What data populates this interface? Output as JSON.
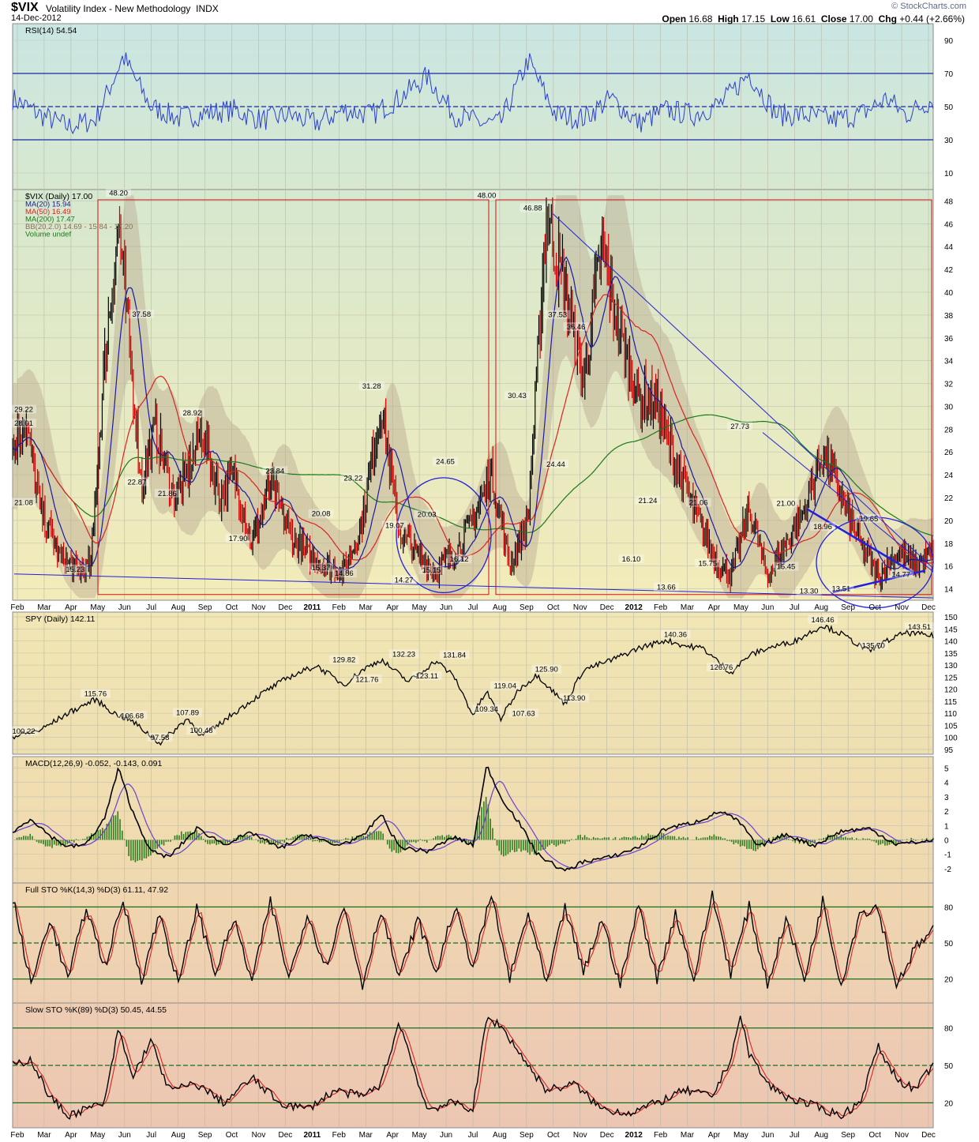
{
  "header": {
    "symbol": "$VIX",
    "name": "Volatility Index - New Methodology",
    "exchange": "INDX",
    "date": "14-Dec-2012",
    "open_label": "Open",
    "open": "16.68",
    "high_label": "High",
    "high": "17.15",
    "low_label": "Low",
    "low": "16.61",
    "close_label": "Close",
    "close": "17.00",
    "chg_label": "Chg",
    "chg": "+0.44 (+2.66%)",
    "credit": "© StockCharts.com"
  },
  "colors": {
    "ma20": "#1a1aa0",
    "ma50": "#dd2222",
    "ma200": "#1a7a1a",
    "bb_fill": "#b7a890",
    "up_bar": "#000000",
    "down_bar": "#cc0000",
    "annotation_box": "#cc1111",
    "annotation_line": "#2020dd",
    "macd_hist": "#2e7d1e",
    "signal": "#6b3fcf"
  },
  "chart_data": [
    {
      "type": "line",
      "panel": "rsi",
      "legend": "RSI(14) 54.54",
      "y_ticks": [
        10,
        30,
        50,
        70,
        90
      ],
      "ylim": [
        0,
        100
      ],
      "reference_lines": [
        30,
        50,
        70
      ],
      "x": [
        0,
        0.03,
        0.06,
        0.09,
        0.12,
        0.15,
        0.18,
        0.21,
        0.24,
        0.27,
        0.3,
        0.33,
        0.36,
        0.39,
        0.42,
        0.45,
        0.48,
        0.51,
        0.53,
        0.56,
        0.59,
        0.62,
        0.65,
        0.68,
        0.71,
        0.74,
        0.77,
        0.8,
        0.83,
        0.86,
        0.89,
        0.92,
        0.95,
        0.97,
        1.0
      ],
      "values": [
        55,
        45,
        38,
        42,
        80,
        50,
        43,
        46,
        48,
        42,
        45,
        40,
        48,
        45,
        55,
        68,
        45,
        40,
        40,
        78,
        45,
        43,
        55,
        40,
        48,
        45,
        52,
        70,
        45,
        45,
        42,
        45,
        55,
        45,
        54.54
      ]
    },
    {
      "type": "candlestick",
      "panel": "price",
      "legend": [
        "$VIX (Daily) 17.00",
        "MA(20) 15.94",
        "MA(50) 16.49",
        "MA(200) 17.47",
        "BB(20,2.0) 14.69 - 15.84 - 17.20",
        "Volume undef"
      ],
      "y_ticks": [
        14,
        16,
        18,
        20,
        22,
        24,
        26,
        28,
        30,
        32,
        34,
        36,
        38,
        40,
        42,
        44,
        46,
        48
      ],
      "ylim": [
        13,
        49
      ],
      "x_ticks": [
        "Feb",
        "Mar",
        "Apr",
        "May",
        "Jun",
        "Jul",
        "Aug",
        "Sep",
        "Oct",
        "Nov",
        "Dec",
        "2011",
        "Feb",
        "Mar",
        "Apr",
        "May",
        "Jun",
        "Jul",
        "Aug",
        "Sep",
        "Oct",
        "Nov",
        "Dec",
        "2012",
        "Feb",
        "Mar",
        "Apr",
        "May",
        "Jun",
        "Jul",
        "Aug",
        "Sep",
        "Oct",
        "Nov",
        "Dec"
      ],
      "close_path": {
        "x": [
          0,
          0.013,
          0.03,
          0.05,
          0.07,
          0.085,
          0.1,
          0.115,
          0.125,
          0.14,
          0.155,
          0.175,
          0.19,
          0.205,
          0.225,
          0.24,
          0.26,
          0.28,
          0.3,
          0.32,
          0.34,
          0.36,
          0.38,
          0.4,
          0.42,
          0.44,
          0.46,
          0.48,
          0.5,
          0.52,
          0.54,
          0.56,
          0.58,
          0.6,
          0.62,
          0.64,
          0.66,
          0.68,
          0.7,
          0.72,
          0.74,
          0.76,
          0.78,
          0.8,
          0.82,
          0.84,
          0.86,
          0.88,
          0.9,
          0.92,
          0.94,
          0.96,
          0.98,
          1.0
        ],
        "values": [
          26,
          29,
          21,
          17,
          15.5,
          16,
          34,
          46,
          37,
          23,
          28,
          22,
          24,
          28,
          22,
          24,
          18,
          23,
          19,
          17,
          16,
          15.5,
          20,
          30,
          19,
          17,
          15.5,
          17,
          20,
          24,
          16,
          20,
          47,
          40,
          32,
          44,
          36,
          31,
          30,
          25,
          21,
          17,
          15,
          21,
          15,
          18,
          21,
          26,
          22,
          18,
          15,
          17,
          16,
          17
        ]
      },
      "point_labels": [
        {
          "x": 0.0,
          "value": 28.01,
          "label": "28.01"
        },
        {
          "x": 0.004,
          "value": 29.22,
          "label": "29.22"
        },
        {
          "x": 0.003,
          "value": 21.08,
          "label": "21.08"
        },
        {
          "x": 0.068,
          "value": 15.23,
          "label": "15.23"
        },
        {
          "x": 0.115,
          "value": 48.2,
          "label": "48.20"
        },
        {
          "x": 0.14,
          "value": 37.58,
          "label": "37.58"
        },
        {
          "x": 0.135,
          "value": 22.87,
          "label": "22.87"
        },
        {
          "x": 0.168,
          "value": 21.86,
          "label": "21.86"
        },
        {
          "x": 0.195,
          "value": 28.92,
          "label": "28.92"
        },
        {
          "x": 0.245,
          "value": 17.9,
          "label": "17.90"
        },
        {
          "x": 0.285,
          "value": 23.84,
          "label": "23.84"
        },
        {
          "x": 0.335,
          "value": 15.37,
          "label": "15.37"
        },
        {
          "x": 0.335,
          "value": 20.08,
          "label": "20.08"
        },
        {
          "x": 0.36,
          "value": 14.86,
          "label": "14.86"
        },
        {
          "x": 0.37,
          "value": 23.22,
          "label": "23.22"
        },
        {
          "x": 0.39,
          "value": 31.28,
          "label": "31.28"
        },
        {
          "x": 0.415,
          "value": 19.07,
          "label": "19.07"
        },
        {
          "x": 0.425,
          "value": 14.27,
          "label": "14.27"
        },
        {
          "x": 0.45,
          "value": 20.03,
          "label": "20.03"
        },
        {
          "x": 0.47,
          "value": 24.65,
          "label": "24.65"
        },
        {
          "x": 0.455,
          "value": 15.15,
          "label": "15.15"
        },
        {
          "x": 0.485,
          "value": 16.12,
          "label": "16.12"
        },
        {
          "x": 0.515,
          "value": 48.0,
          "label": "48.00"
        },
        {
          "x": 0.565,
          "value": 46.88,
          "label": "46.88"
        },
        {
          "x": 0.548,
          "value": 30.43,
          "label": "30.43"
        },
        {
          "x": 0.592,
          "value": 37.53,
          "label": "37.53"
        },
        {
          "x": 0.612,
          "value": 36.46,
          "label": "36.46"
        },
        {
          "x": 0.59,
          "value": 24.44,
          "label": "24.44"
        },
        {
          "x": 0.69,
          "value": 21.24,
          "label": "21.24"
        },
        {
          "x": 0.672,
          "value": 16.1,
          "label": "16.10"
        },
        {
          "x": 0.71,
          "value": 13.66,
          "label": "13.66"
        },
        {
          "x": 0.745,
          "value": 21.06,
          "label": "21.06"
        },
        {
          "x": 0.755,
          "value": 15.75,
          "label": "15.75"
        },
        {
          "x": 0.79,
          "value": 27.73,
          "label": "27.73"
        },
        {
          "x": 0.84,
          "value": 21.0,
          "label": "21.00"
        },
        {
          "x": 0.84,
          "value": 15.45,
          "label": "15.45"
        },
        {
          "x": 0.88,
          "value": 18.96,
          "label": "18.96"
        },
        {
          "x": 0.865,
          "value": 13.3,
          "label": "13.30"
        },
        {
          "x": 0.9,
          "value": 13.51,
          "label": "13.51"
        },
        {
          "x": 0.93,
          "value": 19.65,
          "label": "19.65"
        },
        {
          "x": 0.965,
          "value": 14.77,
          "label": "14.77"
        }
      ]
    },
    {
      "type": "line",
      "panel": "spy",
      "legend": "SPY (Daily) 142.11",
      "y_ticks": [
        95,
        100,
        105,
        110,
        115,
        120,
        125,
        130,
        135,
        140,
        145,
        150
      ],
      "ylim": [
        93,
        152
      ],
      "x": [
        0,
        0.03,
        0.06,
        0.09,
        0.11,
        0.13,
        0.16,
        0.19,
        0.205,
        0.22,
        0.24,
        0.27,
        0.3,
        0.33,
        0.36,
        0.38,
        0.4,
        0.43,
        0.46,
        0.48,
        0.5,
        0.515,
        0.53,
        0.55,
        0.57,
        0.6,
        0.62,
        0.65,
        0.68,
        0.71,
        0.73,
        0.75,
        0.78,
        0.8,
        0.82,
        0.85,
        0.88,
        0.9,
        0.93,
        0.95,
        0.97,
        1.0
      ],
      "values": [
        100.2,
        103,
        110,
        115.8,
        110,
        106.7,
        97.6,
        107.9,
        100.5,
        104,
        110,
        118,
        125,
        129.8,
        121.8,
        128,
        132.2,
        123.1,
        131.8,
        125,
        109.3,
        119,
        107.6,
        120,
        125.9,
        113.9,
        128,
        132,
        137,
        140.4,
        138,
        137,
        126.8,
        134,
        137,
        140,
        146.5,
        143,
        135.7,
        140,
        143.5,
        142.1
      ],
      "point_labels": [
        {
          "x": 0.0,
          "value": 100.22,
          "label": "100.22"
        },
        {
          "x": 0.09,
          "value": 115.76,
          "label": "115.76"
        },
        {
          "x": 0.13,
          "value": 106.68,
          "label": "106.68"
        },
        {
          "x": 0.16,
          "value": 97.58,
          "label": "97.58"
        },
        {
          "x": 0.19,
          "value": 107.89,
          "label": "107.89"
        },
        {
          "x": 0.205,
          "value": 100.48,
          "label": "100.48"
        },
        {
          "x": 0.36,
          "value": 129.82,
          "label": "129.82"
        },
        {
          "x": 0.385,
          "value": 121.76,
          "label": "121.76"
        },
        {
          "x": 0.425,
          "value": 132.23,
          "label": "132.23"
        },
        {
          "x": 0.45,
          "value": 123.11,
          "label": "123.11"
        },
        {
          "x": 0.48,
          "value": 131.84,
          "label": "131.84"
        },
        {
          "x": 0.515,
          "value": 109.34,
          "label": "109.34"
        },
        {
          "x": 0.535,
          "value": 119.04,
          "label": "119.04"
        },
        {
          "x": 0.555,
          "value": 107.63,
          "label": "107.63"
        },
        {
          "x": 0.58,
          "value": 125.9,
          "label": "125.90"
        },
        {
          "x": 0.61,
          "value": 113.9,
          "label": "113.90"
        },
        {
          "x": 0.72,
          "value": 140.36,
          "label": "140.36"
        },
        {
          "x": 0.77,
          "value": 126.76,
          "label": "126.76"
        },
        {
          "x": 0.88,
          "value": 146.46,
          "label": "146.46"
        },
        {
          "x": 0.935,
          "value": 135.7,
          "label": "135.70"
        },
        {
          "x": 0.985,
          "value": 143.51,
          "label": "143.51"
        }
      ]
    },
    {
      "type": "line",
      "panel": "macd",
      "legend": "MACD(12,26,9) -0.052, -0.143, 0.091",
      "y_ticks": [
        -2,
        -1,
        0,
        1,
        2,
        3,
        4,
        5
      ],
      "ylim": [
        -3,
        5.8
      ],
      "x": [
        0,
        0.02,
        0.04,
        0.06,
        0.08,
        0.1,
        0.115,
        0.13,
        0.15,
        0.17,
        0.2,
        0.23,
        0.26,
        0.29,
        0.32,
        0.35,
        0.38,
        0.4,
        0.42,
        0.45,
        0.48,
        0.5,
        0.515,
        0.53,
        0.55,
        0.57,
        0.6,
        0.62,
        0.65,
        0.68,
        0.71,
        0.74,
        0.77,
        0.79,
        0.81,
        0.84,
        0.87,
        0.9,
        0.93,
        0.96,
        1.0
      ],
      "values": [
        0.5,
        1.5,
        0.3,
        -0.5,
        -0.3,
        1.5,
        5,
        2,
        -0.8,
        -1.2,
        0.8,
        -0.3,
        0.5,
        -0.6,
        0.4,
        -0.4,
        0.2,
        1.8,
        -0.5,
        -0.8,
        0.2,
        -0.4,
        5.2,
        3,
        1.2,
        -1,
        -2.2,
        -1.5,
        -1.2,
        -0.5,
        0.8,
        1.2,
        2,
        1.2,
        -0.5,
        0.4,
        -0.4,
        0.6,
        0.8,
        -0.3,
        -0.05
      ],
      "series_names": [
        "MACD",
        "signal",
        "histogram"
      ]
    },
    {
      "type": "line",
      "panel": "full_sto",
      "legend": "Full STO %K(14,3) %D(3) 61.11, 47.92",
      "y_ticks": [
        20,
        50,
        80
      ],
      "ylim": [
        0,
        100
      ],
      "reference_lines": [
        20,
        50,
        80
      ],
      "x": [
        0,
        0.02,
        0.04,
        0.06,
        0.08,
        0.1,
        0.12,
        0.14,
        0.16,
        0.18,
        0.2,
        0.22,
        0.24,
        0.26,
        0.28,
        0.3,
        0.32,
        0.34,
        0.36,
        0.38,
        0.4,
        0.42,
        0.44,
        0.46,
        0.48,
        0.5,
        0.52,
        0.54,
        0.56,
        0.58,
        0.6,
        0.62,
        0.64,
        0.66,
        0.68,
        0.7,
        0.72,
        0.74,
        0.76,
        0.78,
        0.8,
        0.82,
        0.84,
        0.86,
        0.88,
        0.9,
        0.92,
        0.94,
        0.96,
        0.98,
        1.0
      ],
      "values": [
        88,
        15,
        70,
        20,
        80,
        30,
        85,
        20,
        75,
        15,
        80,
        25,
        70,
        18,
        85,
        20,
        75,
        30,
        80,
        15,
        78,
        20,
        70,
        25,
        80,
        30,
        90,
        20,
        75,
        15,
        80,
        25,
        70,
        15,
        82,
        20,
        75,
        20,
        90,
        25,
        80,
        15,
        70,
        20,
        85,
        15,
        75,
        80,
        15,
        45,
        61.1
      ]
    },
    {
      "type": "line",
      "panel": "slow_sto",
      "legend": "Slow STO %K(89) %D(3) 50.45, 44.55",
      "y_ticks": [
        20,
        50,
        80
      ],
      "ylim": [
        0,
        100
      ],
      "reference_lines": [
        20,
        50,
        80
      ],
      "x": [
        0,
        0.02,
        0.04,
        0.06,
        0.08,
        0.1,
        0.115,
        0.13,
        0.15,
        0.17,
        0.2,
        0.23,
        0.26,
        0.29,
        0.32,
        0.35,
        0.38,
        0.4,
        0.42,
        0.45,
        0.48,
        0.5,
        0.515,
        0.53,
        0.56,
        0.58,
        0.61,
        0.64,
        0.67,
        0.7,
        0.73,
        0.76,
        0.78,
        0.79,
        0.8,
        0.82,
        0.84,
        0.86,
        0.88,
        0.9,
        0.92,
        0.94,
        0.96,
        0.98,
        1.0
      ],
      "values": [
        50,
        55,
        25,
        10,
        15,
        20,
        80,
        40,
        70,
        30,
        35,
        20,
        40,
        20,
        15,
        30,
        25,
        35,
        85,
        15,
        20,
        15,
        88,
        82,
        50,
        30,
        35,
        15,
        12,
        20,
        30,
        25,
        55,
        90,
        60,
        35,
        25,
        20,
        15,
        10,
        20,
        65,
        40,
        30,
        50.45
      ]
    }
  ]
}
